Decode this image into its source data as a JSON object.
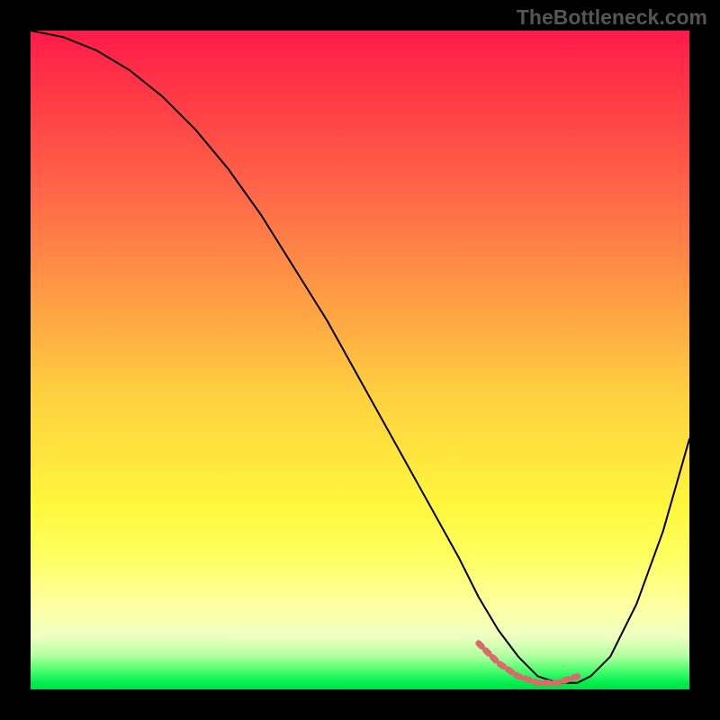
{
  "watermark": "TheBottleneck.com",
  "chart_data": {
    "type": "line",
    "title": "",
    "xlabel": "",
    "ylabel": "",
    "x_range": [
      0,
      100
    ],
    "y_range": [
      0,
      100
    ],
    "series": [
      {
        "name": "bottleneck-curve",
        "x": [
          0,
          5,
          10,
          15,
          20,
          25,
          30,
          35,
          40,
          45,
          50,
          55,
          60,
          65,
          68,
          71,
          74,
          77,
          80,
          83,
          85,
          88,
          92,
          96,
          100
        ],
        "values": [
          100,
          99,
          97,
          94,
          90,
          85,
          79,
          72,
          64,
          56,
          47,
          38,
          29,
          20,
          14,
          9,
          5,
          2,
          1,
          1,
          2,
          5,
          13,
          24,
          38
        ]
      }
    ],
    "highlight_segment": {
      "name": "optimal-zone",
      "x": [
        68,
        71,
        74,
        77,
        80,
        83
      ],
      "values": [
        7,
        4,
        2,
        1,
        1,
        2
      ]
    },
    "gradient": {
      "top_color": "#ff1a4a",
      "mid_color": "#ffe63e",
      "bottom_color": "#00dd40",
      "meaning": "red=high bottleneck, green=low bottleneck"
    }
  }
}
